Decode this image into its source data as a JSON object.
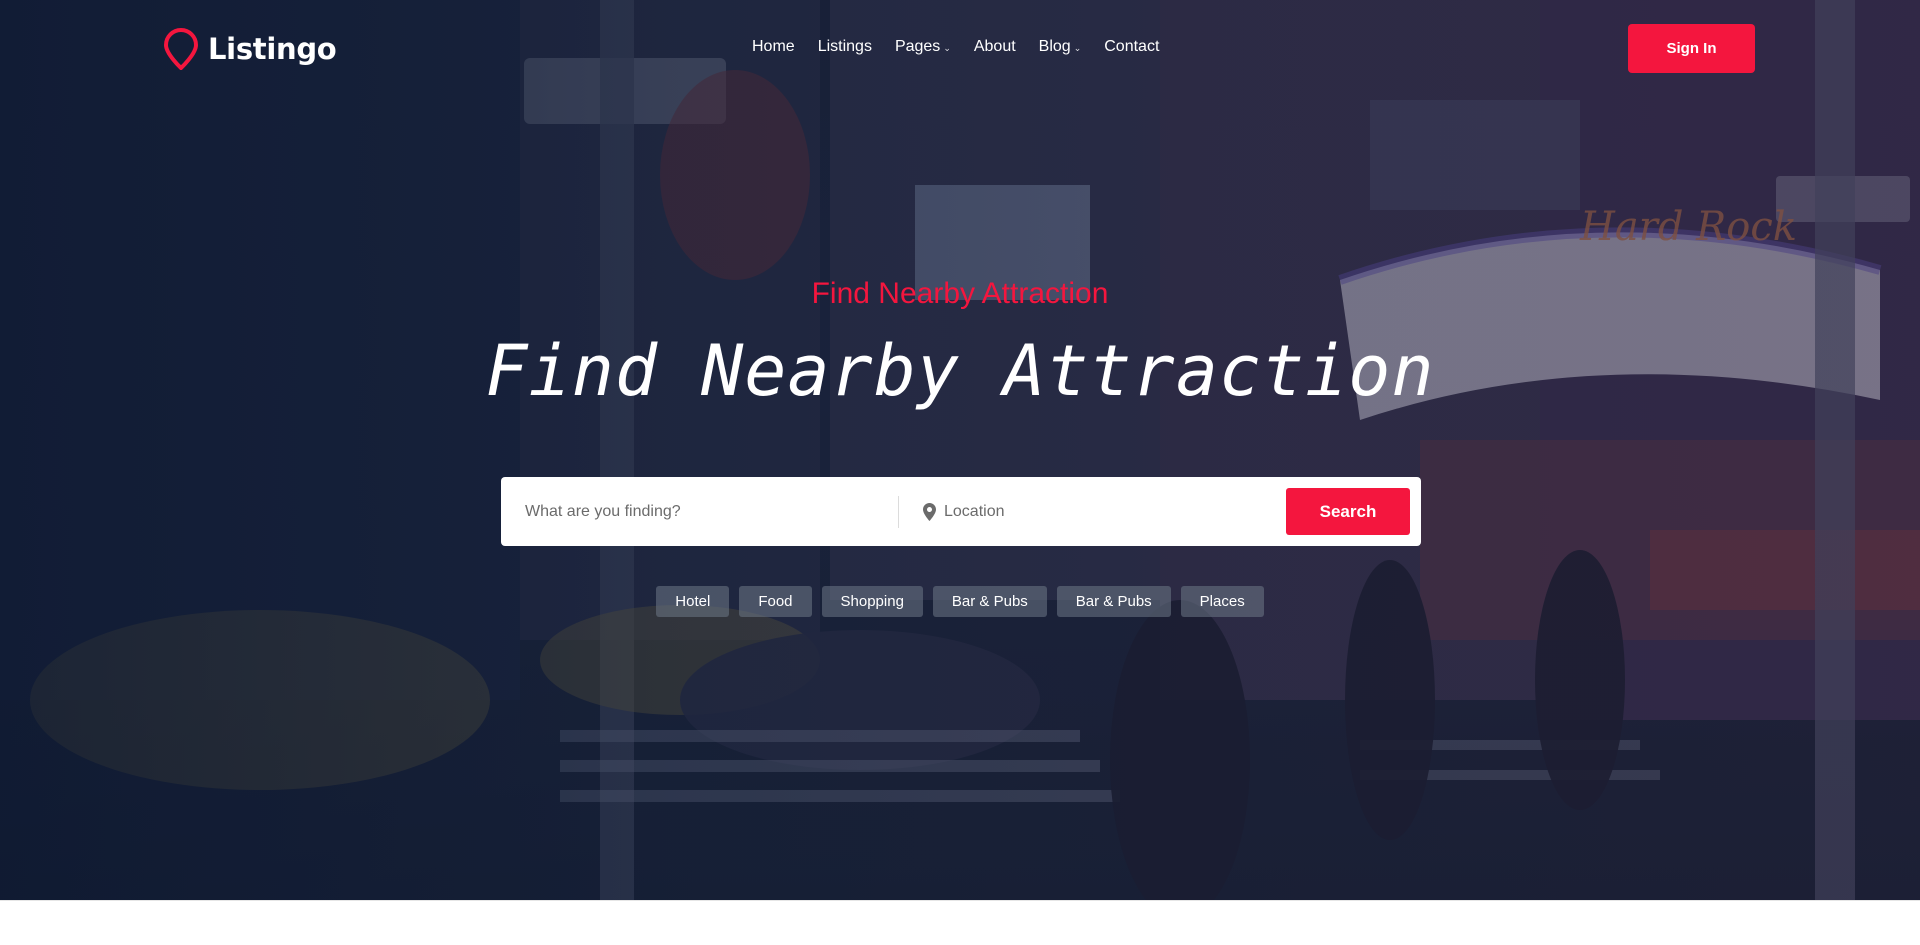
{
  "header": {
    "logo_text": "Listingo",
    "nav": [
      {
        "label": "Home",
        "has_dropdown": false
      },
      {
        "label": "Listings",
        "has_dropdown": false
      },
      {
        "label": "Pages",
        "has_dropdown": true
      },
      {
        "label": "About",
        "has_dropdown": false
      },
      {
        "label": "Blog",
        "has_dropdown": true
      },
      {
        "label": "Contact",
        "has_dropdown": false
      }
    ],
    "signin_label": "Sign In"
  },
  "hero": {
    "subtitle": "Find Nearby Attraction",
    "title": "Find Nearby Attraction",
    "search": {
      "keyword_placeholder": "What are you finding?",
      "location_placeholder": "Location",
      "button_label": "Search"
    },
    "tags": [
      "Hotel",
      "Food",
      "Shopping",
      "Bar & Pubs",
      "Bar & Pubs",
      "Places"
    ]
  },
  "colors": {
    "accent": "#f4163e",
    "overlay": "#1b2740",
    "tag_bg": "#6e7887"
  },
  "icons": {
    "logo": "map-pin-icon",
    "location": "location-pin-icon",
    "dropdown": "chevron-down-icon"
  }
}
